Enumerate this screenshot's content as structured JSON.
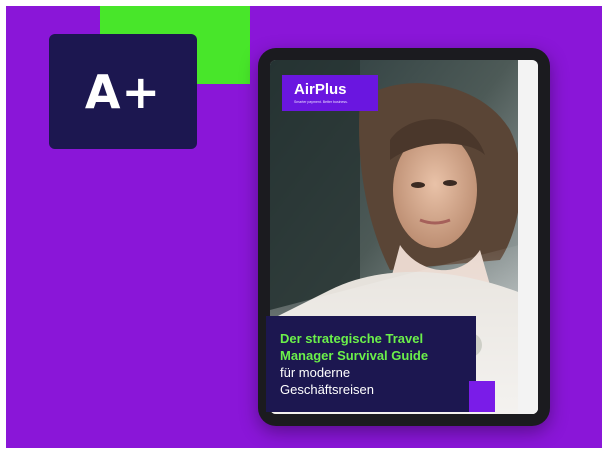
{
  "logo": {
    "text": "A+"
  },
  "ebook": {
    "brand": "AirPlus",
    "brand_tagline": "Smarter payment. Better business.",
    "title_line1": "Der strategische Travel",
    "title_line2": "Manager Survival Guide",
    "title_line3": "für moderne",
    "title_line4": "Geschäftsreisen"
  },
  "colors": {
    "background": "#8a16d8",
    "accent_green": "#48e62a",
    "navy": "#1c1750",
    "brand_purple": "#6a16e0"
  }
}
